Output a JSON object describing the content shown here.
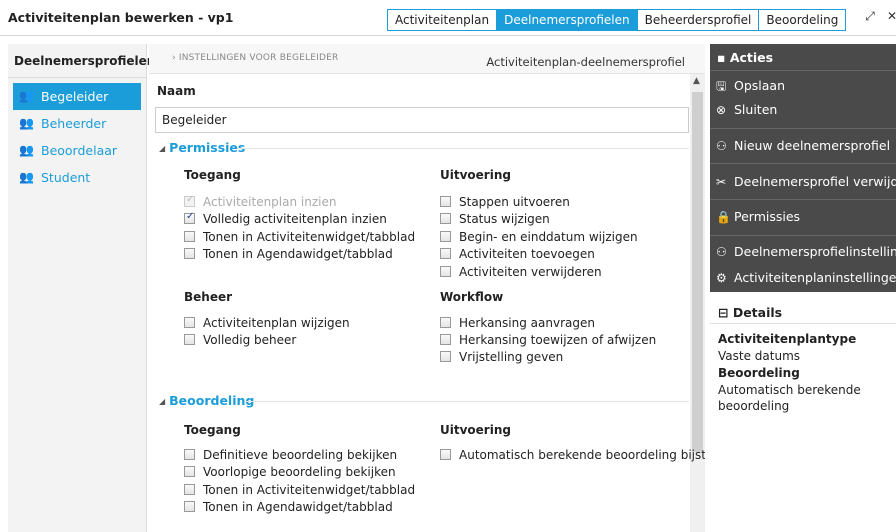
{
  "window": {
    "title": "Activiteitenplan bewerken - vp1",
    "tabs": [
      "Activiteitenplan",
      "Deelnemersprofielen",
      "Beheerdersprofiel",
      "Beoordeling"
    ],
    "active_tab": "Deelnemersprofielen",
    "expand_icon": "expand-icon",
    "close_icon": "close-icon"
  },
  "sidebar": {
    "header": "Deelnemersprofielen",
    "items": [
      {
        "label": "Begeleider",
        "icon": "users-icon",
        "active": true
      },
      {
        "label": "Beheerder",
        "icon": "users-icon",
        "active": false
      },
      {
        "label": "Beoordelaar",
        "icon": "users-icon",
        "active": false
      },
      {
        "label": "Student",
        "icon": "users-icon",
        "active": false
      }
    ]
  },
  "main": {
    "breadcrumb": "› INSTELLINGEN VOOR BEGELEIDER",
    "breadcrumb_right": "Activiteitenplan-deelnemersprofiel",
    "naam_label": "Naam",
    "naam_value": "Begeleider",
    "permissies": {
      "title": "Permissies",
      "toegang": {
        "title": "Toegang",
        "options": [
          {
            "label": "Activiteitenplan inzien",
            "checked": true,
            "disabled": true
          },
          {
            "label": "Volledig activiteitenplan inzien",
            "checked": true,
            "disabled": false
          },
          {
            "label": "Tonen in Activiteitenwidget/tabblad",
            "checked": false,
            "disabled": false
          },
          {
            "label": "Tonen in Agendawidget/tabblad",
            "checked": false,
            "disabled": false
          }
        ]
      },
      "uitvoering": {
        "title": "Uitvoering",
        "options": [
          {
            "label": "Stappen uitvoeren",
            "checked": false
          },
          {
            "label": "Status wijzigen",
            "checked": false
          },
          {
            "label": "Begin- en einddatum wijzigen",
            "checked": false
          },
          {
            "label": "Activiteiten toevoegen",
            "checked": false
          },
          {
            "label": "Activiteiten verwijderen",
            "checked": false
          }
        ]
      },
      "beheer": {
        "title": "Beheer",
        "options": [
          {
            "label": "Activiteitenplan wijzigen",
            "checked": false
          },
          {
            "label": "Volledig beheer",
            "checked": false
          }
        ]
      },
      "workflow": {
        "title": "Workflow",
        "options": [
          {
            "label": "Herkansing aanvragen",
            "checked": false
          },
          {
            "label": "Herkansing toewijzen of afwijzen",
            "checked": false
          },
          {
            "label": "Vrijstelling geven",
            "checked": false
          }
        ]
      }
    },
    "beoordeling": {
      "title": "Beoordeling",
      "toegang": {
        "title": "Toegang",
        "options": [
          {
            "label": "Definitieve beoordeling bekijken",
            "checked": false
          },
          {
            "label": "Voorlopige beoordeling bekijken",
            "checked": false
          },
          {
            "label": "Tonen in Activiteitenwidget/tabblad",
            "checked": false
          },
          {
            "label": "Tonen in Agendawidget/tabblad",
            "checked": false
          }
        ]
      },
      "uitvoering": {
        "title": "Uitvoering",
        "options": [
          {
            "label": "Automatisch berekende beoordeling bijst",
            "checked": false
          }
        ]
      }
    }
  },
  "acties": {
    "title": "Acties",
    "items": [
      {
        "label": "Opslaan",
        "icon": "save-icon"
      },
      {
        "label": "Sluiten",
        "icon": "close-circle-icon"
      },
      {
        "label": "Nieuw deelnemersprofiel",
        "icon": "add-users-icon"
      },
      {
        "label": "Deelnemersprofiel verwijd...",
        "icon": "delete-icon"
      },
      {
        "label": "Permissies",
        "icon": "lock-icon"
      },
      {
        "label": "Deelnemersprofielinstellin...",
        "icon": "users-settings-icon"
      },
      {
        "label": "Activiteitenplaninstellingen",
        "icon": "plan-settings-icon"
      }
    ]
  },
  "details": {
    "title": "Details",
    "type_label": "Activiteitenplantype",
    "type_value": "Vaste datums",
    "beoordeling_label": "Beoordeling",
    "beoordeling_value": "Automatisch berekende beoordeling"
  },
  "colors": {
    "accent": "#1b9dd9",
    "actions_bg": "#4a4a4a"
  }
}
